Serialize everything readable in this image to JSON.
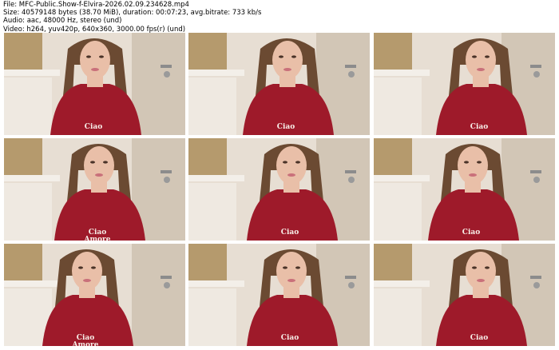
{
  "header": {
    "line1": "File: MFC-Public.Show-f-Elvira-2026.02.09.234628.mp4",
    "line2": "Size: 40579148 bytes (38.70 MiB), duration: 00:07:23, avg.bitrate: 733 kb/s",
    "line3": "Audio: aac, 48000 Hz, stereo (und)",
    "line4": "Video: h264, yuv420p, 640x360, 3000.00 fps(r) (und)"
  },
  "thumbnails": [
    {
      "shirt_text": "Ciao"
    },
    {
      "shirt_text": "Ciao"
    },
    {
      "shirt_text": "Ciao"
    },
    {
      "shirt_text": "Ciao Amore"
    },
    {
      "shirt_text": "Ciao"
    },
    {
      "shirt_text": "Ciao"
    },
    {
      "shirt_text": "Ciao Amore"
    },
    {
      "shirt_text": "Ciao"
    },
    {
      "shirt_text": "Ciao"
    }
  ],
  "colors": {
    "wall": "#e7ded3",
    "blind": "#b59a6d",
    "door": "#d2c6b6",
    "shirt": "#9e1a2a",
    "hair": "#6b4a32",
    "skin": "#e9bfa8"
  }
}
